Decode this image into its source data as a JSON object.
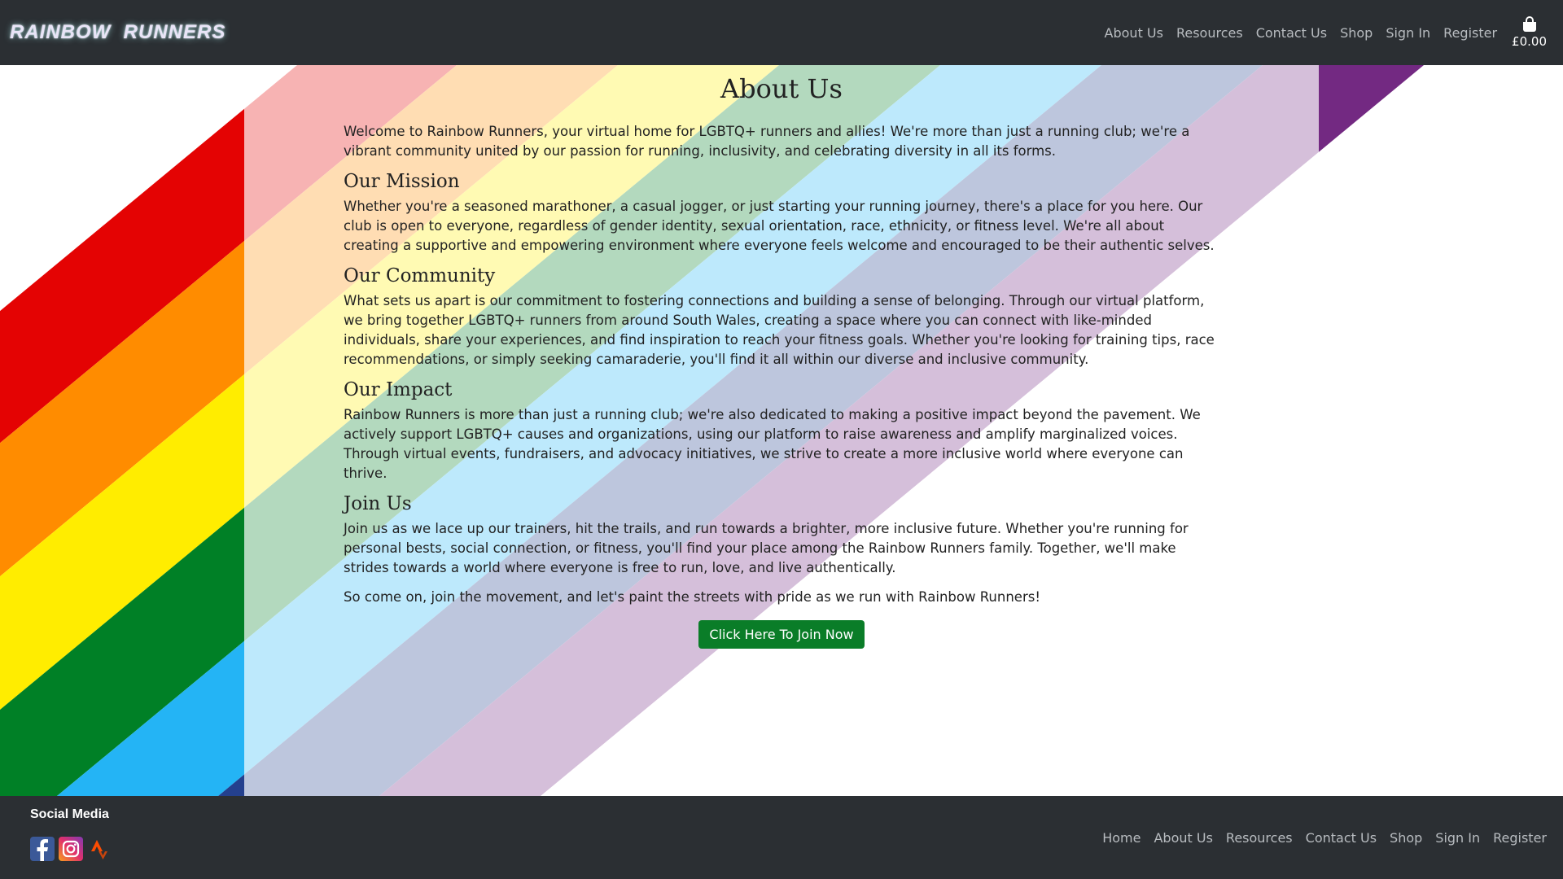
{
  "header": {
    "logo_text": "RAINBOW  RUNNERS",
    "nav": [
      {
        "label": "About Us"
      },
      {
        "label": "Resources"
      },
      {
        "label": "Contact Us"
      },
      {
        "label": "Shop"
      },
      {
        "label": "Sign In"
      },
      {
        "label": "Register"
      }
    ],
    "bag_total": "£0.00",
    "bag_icon": "shopping-bag-icon"
  },
  "main": {
    "title": "About Us",
    "intro": "Welcome to Rainbow Runners, your virtual home for LGBTQ+ runners and allies! We're more than just a running club; we're a vibrant community united by our passion for running, inclusivity, and celebrating diversity in all its forms.",
    "sections": [
      {
        "heading": "Our Mission",
        "text": "Whether you're a seasoned marathoner, a casual jogger, or just starting your running journey, there's a place for you here. Our club is open to everyone, regardless of gender identity, sexual orientation, race, ethnicity, or fitness level. We're all about creating a supportive and empowering environment where everyone feels welcome and encouraged to be their authentic selves."
      },
      {
        "heading": "Our Community",
        "text": "What sets us apart is our commitment to fostering connections and building a sense of belonging. Through our virtual platform, we bring together LGBTQ+ runners from around South Wales, creating a space where you can connect with like-minded individuals, share your experiences, and find inspiration to reach your fitness goals. Whether you're looking for training tips, race recommendations, or simply seeking camaraderie, you'll find it all within our diverse and inclusive community."
      },
      {
        "heading": "Our Impact",
        "text": "Rainbow Runners is more than just a running club; we're also dedicated to making a positive impact beyond the pavement. We actively support LGBTQ+ causes and organizations, using our platform to raise awareness and amplify marginalized voices. Through virtual events, fundraisers, and advocacy initiatives, we strive to create a more inclusive world where everyone can thrive."
      },
      {
        "heading": "Join Us",
        "text": "Join us as we lace up our trainers, hit the trails, and run towards a brighter, more inclusive future. Whether you're running for personal bests, social connection, or fitness, you'll find your place among the Rainbow Runners family. Together, we'll make strides towards a world where everyone is free to run, love, and live authentically."
      }
    ],
    "closing": "So come on, join the movement, and let's paint the streets with pride as we run with Rainbow Runners!",
    "cta_label": "Click Here To Join Now"
  },
  "colors": {
    "header_bg": "#2b2f33",
    "cta_green": "#0a7d28",
    "stripes": [
      "#e40303",
      "#ff8c00",
      "#ffed00",
      "#008026",
      "#24b4f5",
      "#24408e",
      "#732982"
    ]
  },
  "footer": {
    "social_title": "Social Media",
    "social_icons": [
      "facebook-icon",
      "instagram-icon",
      "strava-icon"
    ],
    "nav": [
      {
        "label": "Home"
      },
      {
        "label": "About Us"
      },
      {
        "label": "Resources"
      },
      {
        "label": "Contact Us"
      },
      {
        "label": "Shop"
      },
      {
        "label": "Sign In"
      },
      {
        "label": "Register"
      }
    ]
  }
}
